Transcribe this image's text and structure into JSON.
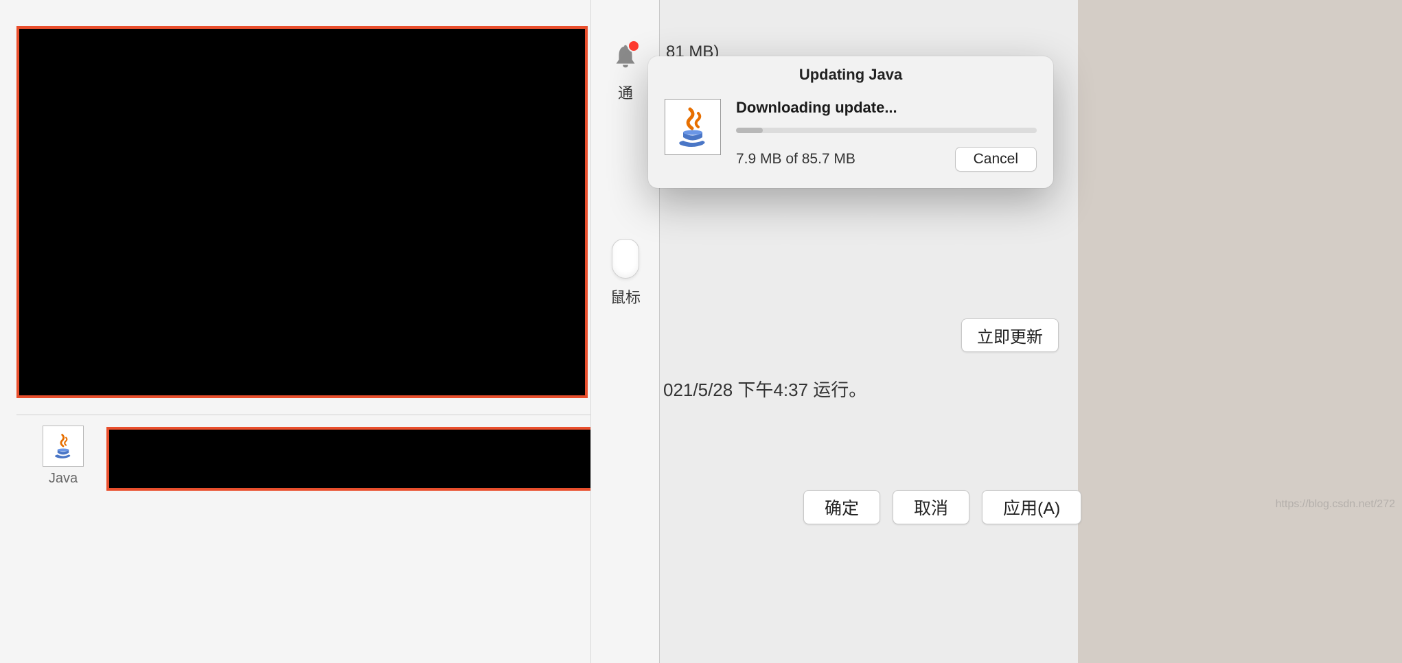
{
  "sidebar": {
    "notifications_label_partial": "通",
    "mouse_label": "鼠标"
  },
  "tile": {
    "java_label": "Java"
  },
  "right": {
    "size_fragment": "81 MB)",
    "last_run": "021/5/28 下午4:37 运行。",
    "update_now": "立即更新"
  },
  "bottom": {
    "ok": "确定",
    "cancel": "取消",
    "apply": "应用(A)"
  },
  "dialog": {
    "title": "Updating Java",
    "heading": "Downloading update...",
    "progress_text": "7.9 MB of 85.7 MB",
    "progress_percent": 9,
    "cancel": "Cancel"
  },
  "watermark": "https://blog.csdn.net/272"
}
